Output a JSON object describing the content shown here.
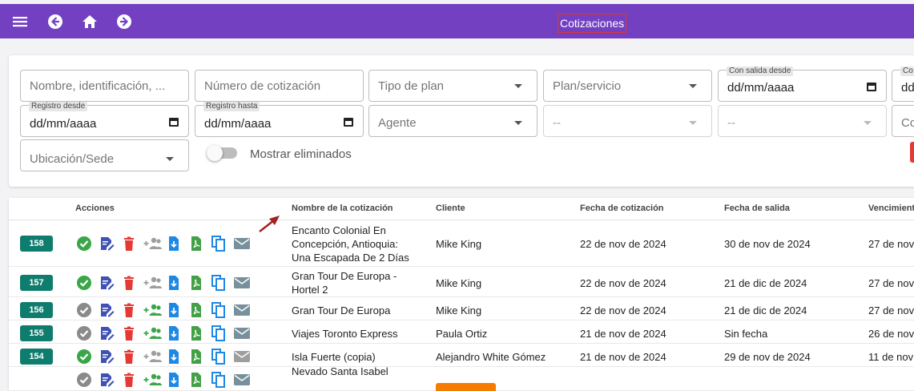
{
  "header": {
    "title": "Cotizaciones",
    "icons": [
      "menu-icon",
      "back-icon",
      "home-icon",
      "forward-icon"
    ]
  },
  "filters": {
    "search_placeholder": "Nombre, identificación, ...",
    "quote_number_placeholder": "Número de cotización",
    "plan_type_placeholder": "Tipo de plan",
    "plan_service_placeholder": "Plan/servicio",
    "departure_from_label": "Con salida desde",
    "departure_from_value": "dd/mm/aaaa",
    "departure_to_label": "Co",
    "departure_to_value": "dd",
    "registered_from_label": "Registro desde",
    "registered_from_value": "dd/mm/aaaa",
    "registered_to_label": "Registro hasta",
    "registered_to_value": "dd/mm/aaaa",
    "agent_placeholder": "Agente",
    "disabled_select_1": "--",
    "disabled_select_2": "--",
    "cut_field": "Co",
    "location_placeholder": "Ubicación/Sede",
    "show_deleted_label": "Mostrar eliminados",
    "show_deleted_on": false
  },
  "table": {
    "headers": {
      "actions": "Acciones",
      "name": "Nombre de la cotización",
      "client": "Cliente",
      "quote_date": "Fecha de cotización",
      "departure_date": "Fecha de salida",
      "expiration": "Vencimiento"
    },
    "rows": [
      {
        "id": "158",
        "name": "Encanto Colonial En Concepción, Antioquia: Una Escapada De 2 Días",
        "client": "Mike King",
        "quote_date": "22 de nov de 2024",
        "departure": "30 de nov de 2024",
        "expiration": "27 de nov"
      },
      {
        "id": "157",
        "name": "Gran Tour De Europa - Hortel 2",
        "client": "Mike King",
        "quote_date": "22 de nov de 2024",
        "departure": "21 de dic de 2024",
        "expiration": "27 de nov"
      },
      {
        "id": "156",
        "name": "Gran Tour De Europa",
        "client": "Mike King",
        "quote_date": "22 de nov de 2024",
        "departure": "21 de dic de 2024",
        "expiration": "27 de nov"
      },
      {
        "id": "155",
        "name": "Viajes Toronto Express",
        "client": "Paula Ortiz",
        "quote_date": "21 de nov de 2024",
        "departure": "Sin fecha",
        "expiration": "26 de nov"
      },
      {
        "id": "154",
        "name": "Isla Fuerte (copia)",
        "client": "Alejandro White Gómez",
        "quote_date": "21 de nov de 2024",
        "departure": "29 de nov de 2024",
        "expiration": "11 de nov"
      },
      {
        "id": "",
        "name": "Nevado Santa Isabel",
        "client": "",
        "quote_date": "",
        "departure": "",
        "expiration": ""
      }
    ],
    "colors": {
      "approve_active": "#3aa648",
      "approve_inactive": "#8a8a8a",
      "badge": "#0e7d6e"
    }
  }
}
